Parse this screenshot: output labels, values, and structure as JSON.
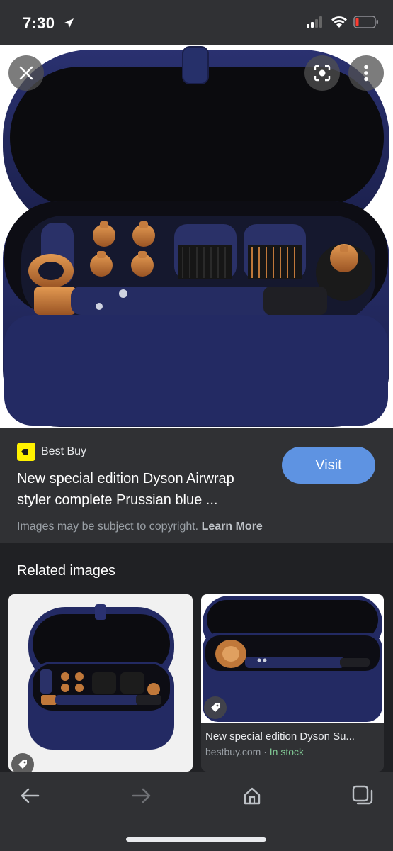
{
  "status_bar": {
    "time": "7:30",
    "icons": [
      "location-arrow-icon",
      "cellular-signal-icon",
      "wifi-icon",
      "battery-low-icon"
    ],
    "battery_color": "#ff3b30"
  },
  "image_viewer": {
    "close_icon": "close-icon",
    "lens_icon": "google-lens-icon",
    "more_icon": "more-vertical-icon"
  },
  "result": {
    "source": "Best Buy",
    "source_logo_color": "#fff200",
    "title": "New special edition Dyson Airwrap styler complete Prussian blue ...",
    "visit_label": "Visit",
    "visit_color": "#5e93e2",
    "copyright_text": "Images may be subject to copyright.",
    "learn_more": "Learn More"
  },
  "related": {
    "heading": "Related images",
    "cards": [
      {
        "tag_icon": "price-tag-icon"
      },
      {
        "tag_icon": "price-tag-icon",
        "title": "New special edition Dyson Su...",
        "domain": "bestbuy.com",
        "separator": "·",
        "stock": "In stock",
        "stock_color": "#81c995"
      }
    ]
  },
  "bottom_nav": {
    "items": [
      "back-arrow-icon",
      "forward-arrow-icon",
      "home-icon",
      "tabs-icon"
    ]
  },
  "colors": {
    "case_blue": "#1f2456",
    "copper": "#c0783a",
    "background": "#202124",
    "panel": "#303134"
  }
}
